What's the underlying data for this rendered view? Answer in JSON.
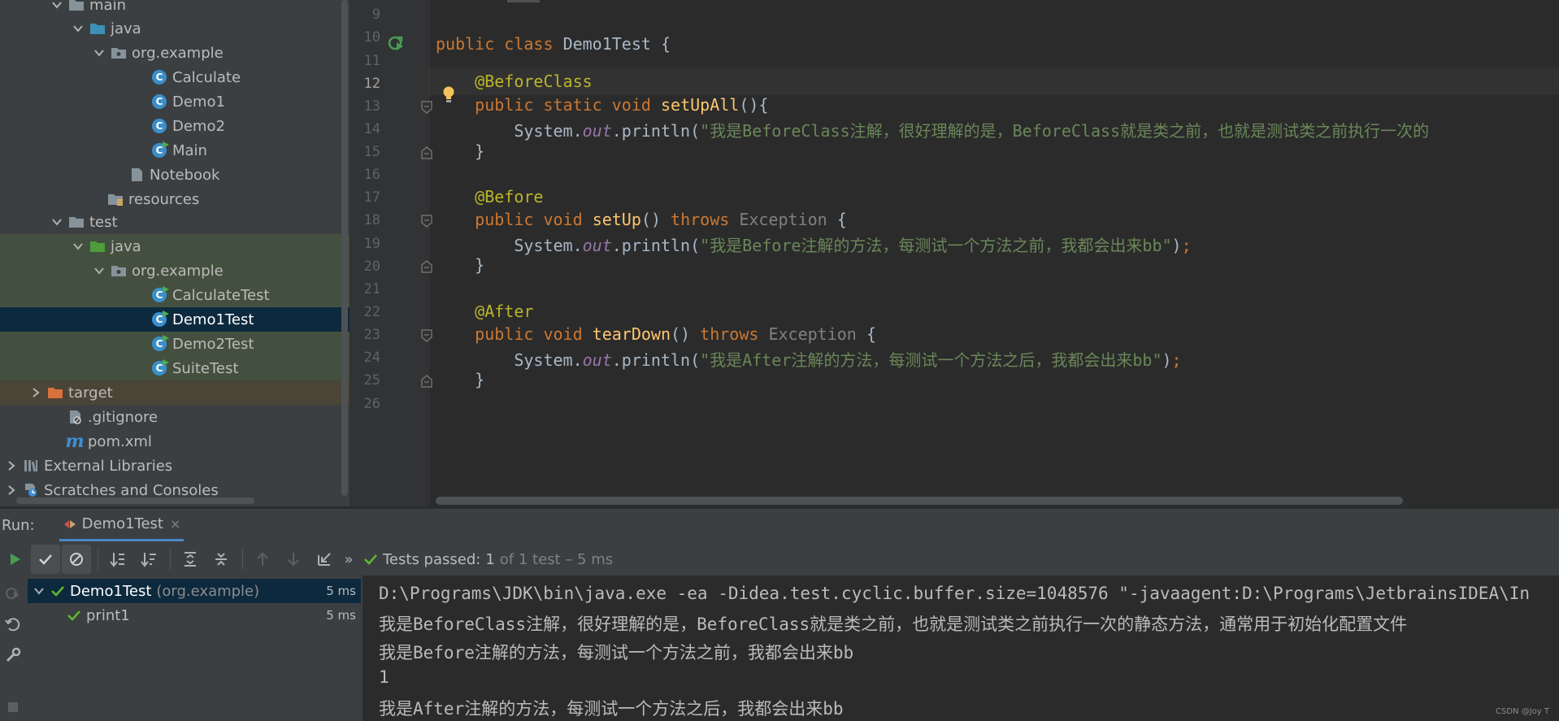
{
  "project_tree": {
    "items": [
      {
        "label": "main",
        "icon": "folder-icon"
      },
      {
        "label": "java",
        "icon": "source-folder-icon"
      },
      {
        "label": "org.example",
        "icon": "package-icon"
      },
      {
        "label": "Calculate",
        "icon": "class-icon"
      },
      {
        "label": "Demo1",
        "icon": "class-icon"
      },
      {
        "label": "Demo2",
        "icon": "class-icon"
      },
      {
        "label": "Main",
        "icon": "runnable-class-icon"
      },
      {
        "label": "Notebook",
        "icon": "file-icon"
      },
      {
        "label": "resources",
        "icon": "resources-folder-icon"
      },
      {
        "label": "test",
        "icon": "folder-icon"
      },
      {
        "label": "java",
        "icon": "test-source-folder-icon"
      },
      {
        "label": "org.example",
        "icon": "package-icon"
      },
      {
        "label": "CalculateTest",
        "icon": "test-class-icon"
      },
      {
        "label": "Demo1Test",
        "icon": "test-class-icon"
      },
      {
        "label": "Demo2Test",
        "icon": "test-class-icon"
      },
      {
        "label": "SuiteTest",
        "icon": "test-class-icon"
      },
      {
        "label": "target",
        "icon": "excluded-folder-icon"
      },
      {
        "label": ".gitignore",
        "icon": "gitignore-icon"
      },
      {
        "label": "pom.xml",
        "icon": "maven-icon"
      },
      {
        "label": "External Libraries",
        "icon": "libraries-icon"
      },
      {
        "label": "Scratches and Consoles",
        "icon": "scratches-icon"
      }
    ],
    "class_letter": "C",
    "maven_letter": "m"
  },
  "editor": {
    "line_numbers": [
      "9",
      "10",
      "11",
      "12",
      "13",
      "14",
      "15",
      "16",
      "17",
      "18",
      "19",
      "20",
      "21",
      "22",
      "23",
      "24",
      "25",
      "26"
    ],
    "current_line": "12",
    "code": {
      "l10": {
        "kw1": "public",
        "kw2": "class",
        "name": "Demo1Test",
        "brace": "{"
      },
      "l12": {
        "ann": "@BeforeClass"
      },
      "l13": {
        "kw1": "public",
        "kw2": "static",
        "kw3": "void",
        "fn": "setUpAll",
        "rest": "(){"
      },
      "l14": {
        "obj": "System.",
        "fld": "out",
        "call": ".println(",
        "str": "\"我是BeforeClass注解，很好理解的是，BeforeClass就是类之前，也就是测试类之前执行一次的"
      },
      "l15": {
        "text": "}"
      },
      "l17": {
        "ann": "@Before"
      },
      "l18": {
        "kw1": "public",
        "kw2": "void",
        "fn": "setUp",
        "paren": "()",
        "kw3": "throws",
        "exc": "Exception",
        "brace": "{"
      },
      "l19": {
        "obj": "System.",
        "fld": "out",
        "call": ".println(",
        "str": "\"我是Before注解的方法，每测试一个方法之前，我都会出来bb\"",
        "end": ")",
        "semi": ";"
      },
      "l20": {
        "text": "}"
      },
      "l22": {
        "ann": "@After"
      },
      "l23": {
        "kw1": "public",
        "kw2": "void",
        "fn": "tearDown",
        "paren": "()",
        "kw3": "throws",
        "exc": "Exception",
        "brace": "{"
      },
      "l24": {
        "obj": "System.",
        "fld": "out",
        "call": ".println(",
        "str": "\"我是After注解的方法，每测试一个方法之后，我都会出来bb\"",
        "end": ")",
        "semi": ";"
      },
      "l25": {
        "text": "}"
      }
    }
  },
  "run_window": {
    "label": "Run:",
    "tab_label": "Demo1Test",
    "tab_close": "×",
    "more": "»",
    "status": {
      "passed": "Tests passed:",
      "count": "1",
      "detail": "of 1 test – 5 ms"
    },
    "tests": [
      {
        "name": "Demo1Test",
        "package": "(org.example)",
        "time": "5 ms"
      },
      {
        "name": "print1",
        "time": "5 ms"
      }
    ],
    "console_lines": [
      "D:\\Programs\\JDK\\bin\\java.exe -ea -Didea.test.cyclic.buffer.size=1048576 \"-javaagent:D:\\Programs\\JetbrainsIDEA\\In",
      "我是BeforeClass注解，很好理解的是，BeforeClass就是类之前，也就是测试类之前执行一次的静态方法，通常用于初始化配置文件",
      "我是Before注解的方法，每测试一个方法之前，我都会出来bb",
      "1",
      "我是After注解的方法，每测试一个方法之后，我都会出来bb"
    ]
  },
  "watermark": "CSDN @Joy T",
  "colors": {
    "keyword": "#cc7832",
    "annotation": "#bbb529",
    "method": "#ffc66d",
    "string": "#6a8759",
    "field": "#9876aa",
    "pass_green": "#5fb832",
    "selection": "#0d293e"
  }
}
